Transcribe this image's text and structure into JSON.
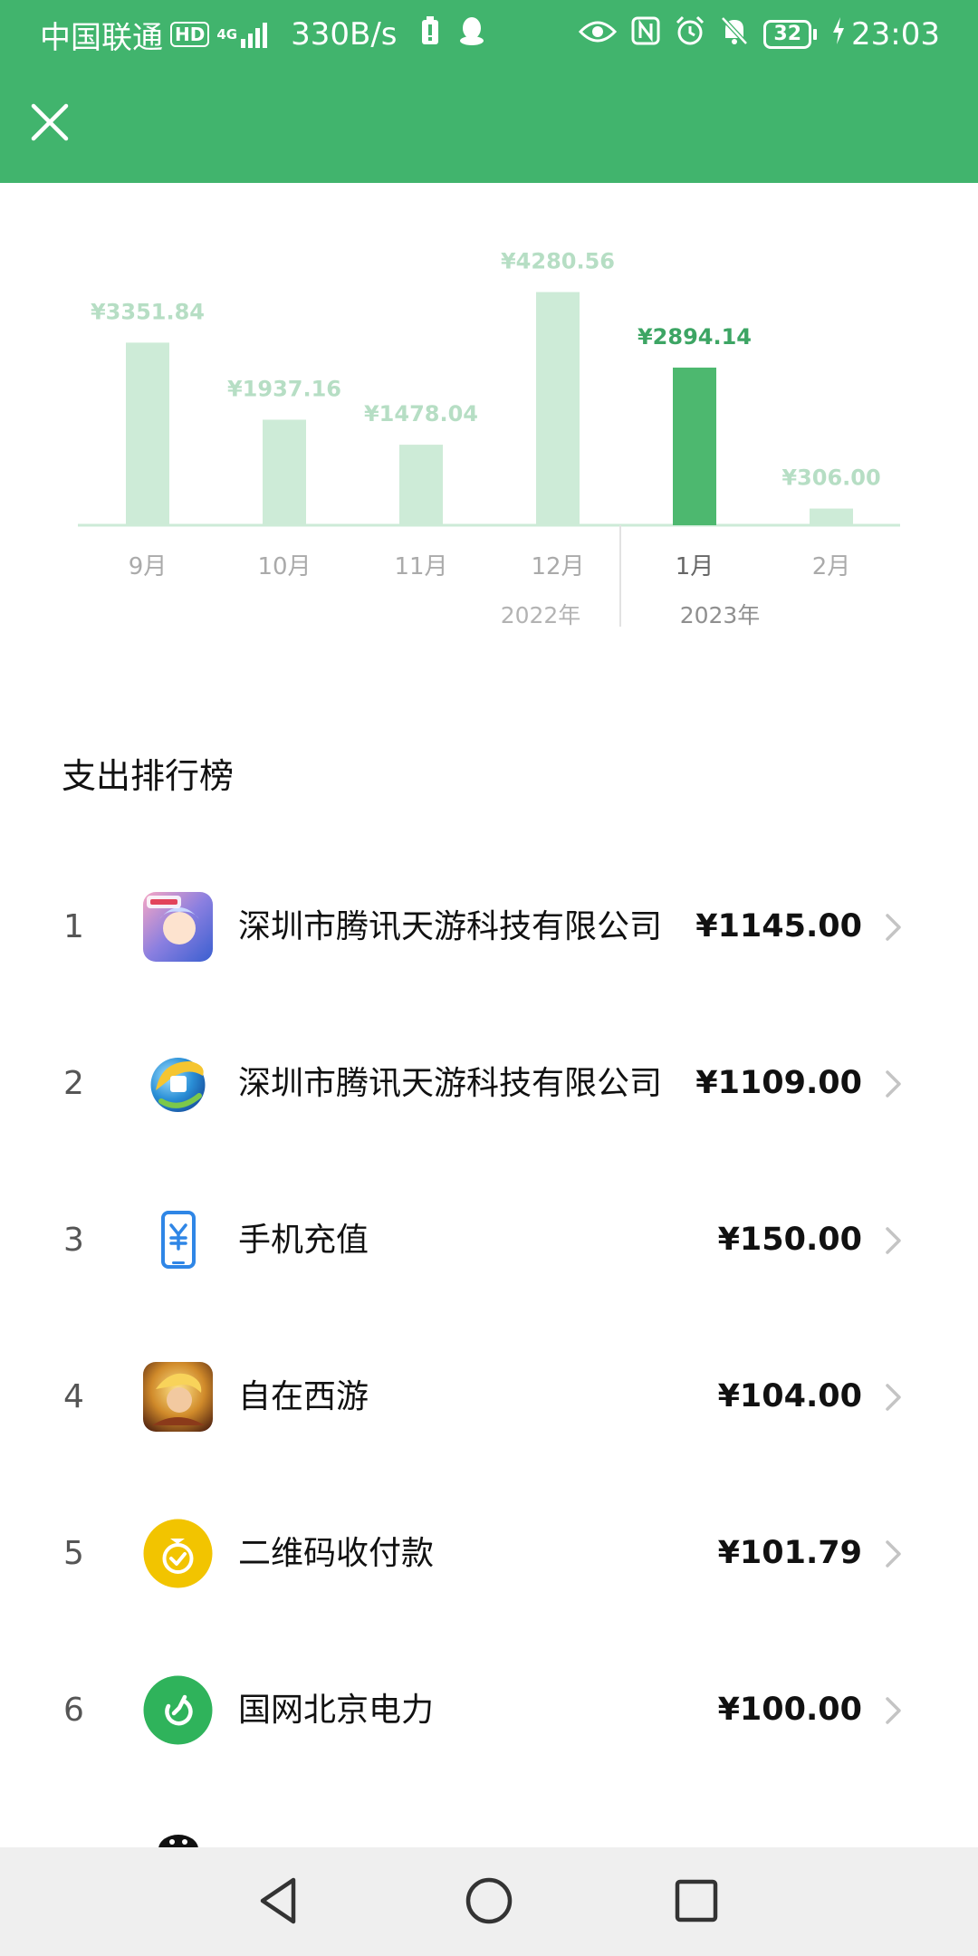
{
  "status_bar": {
    "carrier": "中国联通",
    "hd": "HD",
    "network": "4G",
    "speed": "330B/s",
    "battery": "32",
    "time": "23:03"
  },
  "chart_data": {
    "type": "bar",
    "categories": [
      "9月",
      "10月",
      "11月",
      "12月",
      "1月",
      "2月"
    ],
    "values": [
      3351.84,
      1937.16,
      1478.04,
      4280.56,
      2894.14,
      306.0
    ],
    "value_labels": [
      "¥3351.84",
      "¥1937.16",
      "¥1478.04",
      "¥4280.56",
      "¥2894.14",
      "¥306.00"
    ],
    "year_labels": [
      "2022年",
      "2023年"
    ],
    "selected_index": 4,
    "colors": {
      "bar": "#cdebd7",
      "bar_selected": "#4db86f",
      "label": "#b6dec4",
      "label_selected": "#3da564",
      "axis": "#cdebd7"
    }
  },
  "ranking": {
    "title": "支出排行榜",
    "items": [
      {
        "rank": "1",
        "name": "深圳市腾讯天游科技有限公司",
        "amount": "¥1145.00",
        "icon": "game-app-icon"
      },
      {
        "rank": "2",
        "name": "深圳市腾讯天游科技有限公司",
        "amount": "¥1109.00",
        "icon": "qq-browser-icon"
      },
      {
        "rank": "3",
        "name": "手机充值",
        "amount": "¥150.00",
        "icon": "phone-topup-icon"
      },
      {
        "rank": "4",
        "name": "自在西游",
        "amount": "¥104.00",
        "icon": "game-zizaixiyou-icon"
      },
      {
        "rank": "5",
        "name": "二维码收付款",
        "amount": "¥101.79",
        "icon": "qr-payment-icon"
      },
      {
        "rank": "6",
        "name": "国网北京电力",
        "amount": "¥100.00",
        "icon": "state-grid-icon"
      }
    ]
  },
  "colors": {
    "header_bg": "#41b46d",
    "accent": "#4db86f"
  }
}
